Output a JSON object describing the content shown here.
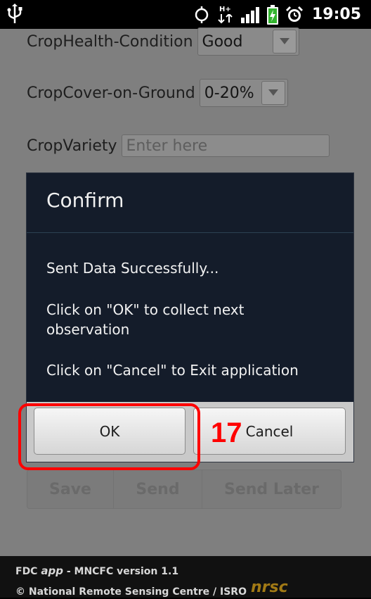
{
  "status_bar": {
    "time": "19:05",
    "network_label": "H+",
    "icons": [
      "usb-icon",
      "sync-icon",
      "data-activity-icon",
      "signal-icon",
      "battery-charging-icon",
      "alarm-icon"
    ]
  },
  "form": {
    "crop_health": {
      "label": "CropHealth-Condition",
      "value": "Good"
    },
    "crop_cover": {
      "label": "CropCover-on-Ground",
      "value": "0-20%"
    },
    "crop_variety": {
      "label": "CropVariety",
      "placeholder": "Enter here"
    },
    "buttons": {
      "save": "Save",
      "send": "Send",
      "send_later": "Send Later"
    }
  },
  "dialog": {
    "title": "Confirm",
    "message_1": "Sent Data  Successfully...",
    "message_2": " Click on \"OK\" to collect next observation",
    "message_3": " Click on \"Cancel\" to Exit application",
    "ok_label": "OK",
    "cancel_label": "Cancel"
  },
  "footer": {
    "app_prefix": "FDC ",
    "app_word": "app",
    "app_suffix": " - MNCFC version 1.1",
    "copyright": "© National Remote Sensing Centre / ISRO",
    "logo_text": "nrsc"
  },
  "annotation": {
    "step_number": "17",
    "color": "#ff0000"
  },
  "colors": {
    "dialog_background": "#141c2a",
    "dimmed_background": "#7f7f7f",
    "status_bar": "#000000",
    "footer": "#111111",
    "logo": "#a27a15"
  }
}
